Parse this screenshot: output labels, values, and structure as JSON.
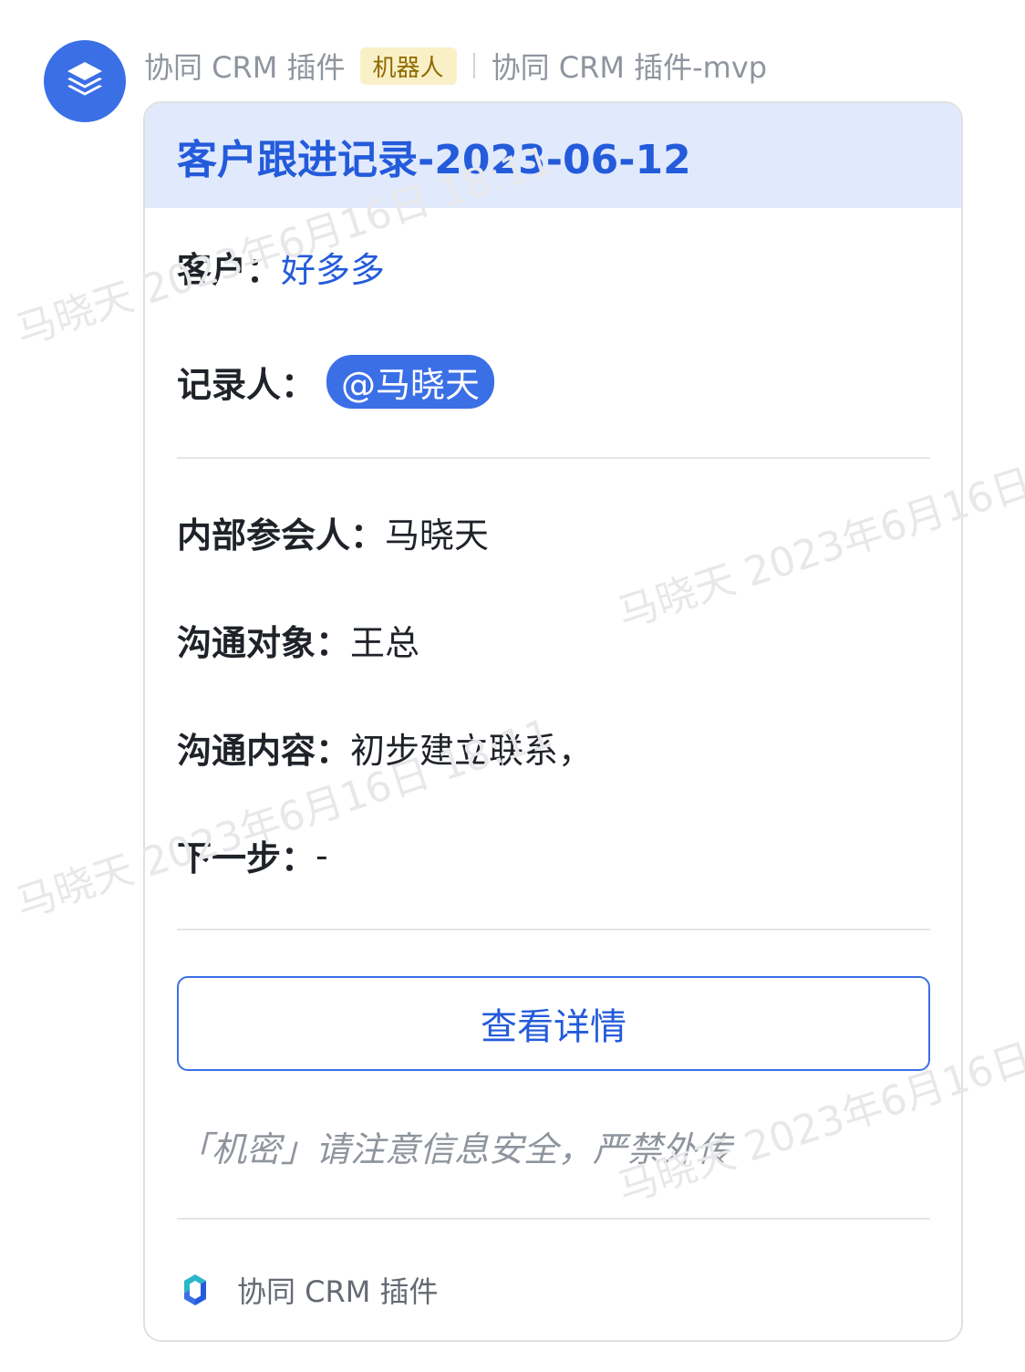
{
  "sender": {
    "name": "协同 CRM 插件",
    "tag": "机器人",
    "source": "协同 CRM 插件-mvp"
  },
  "card": {
    "title": "客户跟进记录-2023-06-12",
    "customer_label": "客户：",
    "customer_value": "好多多",
    "recorder_label": "记录人：",
    "recorder_value": "@马晓天",
    "participants_label": "内部参会人：",
    "participants_value": "马晓天",
    "contact_label": "沟通对象：",
    "contact_value": "王总",
    "content_label": "沟通内容：",
    "content_value": "初步建立联系，",
    "next_label": "下一步：",
    "next_value": "-",
    "button_label": "查看详情",
    "notice": "「机密」请注意信息安全，严禁外传",
    "footer_name": "协同 CRM 插件"
  },
  "watermark": "马晓天 2023年6月16日 18:11",
  "colors": {
    "accent": "#245bdb",
    "header_bg": "#e1eafd",
    "avatar_bg": "#3b6fe6",
    "tag_bg": "#faf0c8"
  },
  "icons": {
    "avatar": "layers-icon",
    "footer": "crm-logo-icon"
  }
}
